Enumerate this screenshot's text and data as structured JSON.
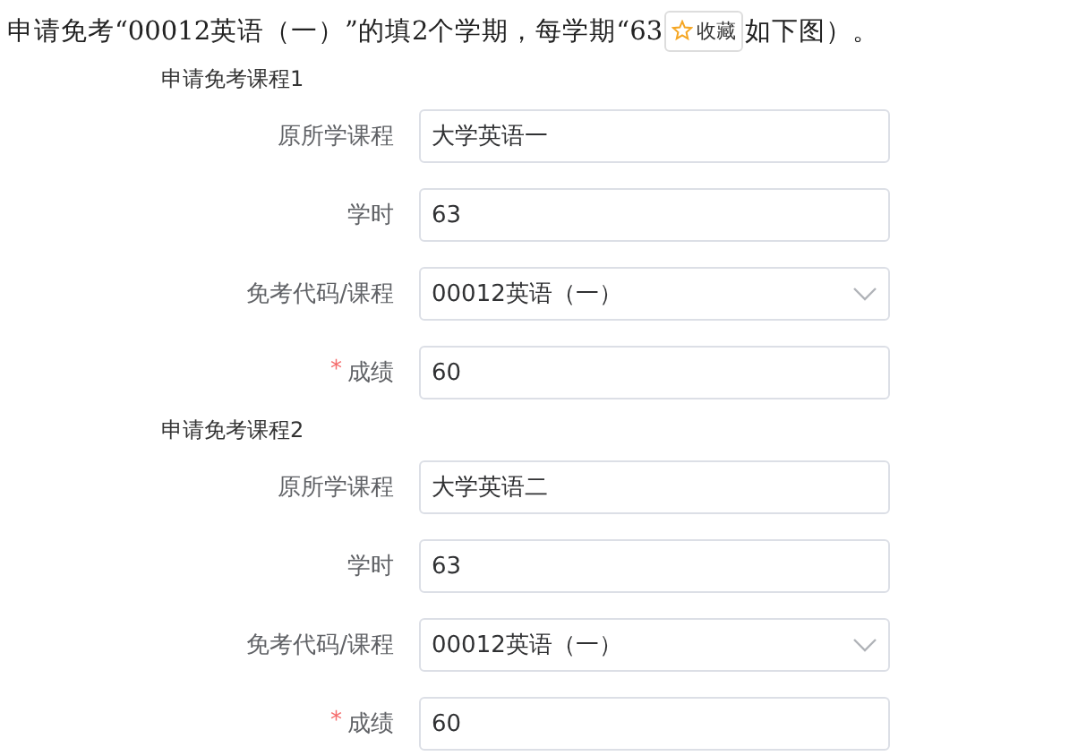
{
  "question": {
    "text_before": "申请免考“00012英语（一）”的填2个学期，每学期“63",
    "text_after": "如下图）。"
  },
  "bookmark_button": {
    "label": "收藏"
  },
  "sections": [
    {
      "title": "申请免考课程1",
      "fields": [
        {
          "label": "原所学课程",
          "kind": "text",
          "value": "大学英语一"
        },
        {
          "label": "学时",
          "kind": "text",
          "value": "63"
        },
        {
          "label": "免考代码/课程",
          "kind": "select",
          "value": "00012英语（一）"
        },
        {
          "required_mark": "*",
          "label": "成绩",
          "kind": "text",
          "value": "60"
        }
      ]
    },
    {
      "title": "申请免考课程2",
      "fields": [
        {
          "label": "原所学课程",
          "kind": "text",
          "value": "大学英语二"
        },
        {
          "label": "学时",
          "kind": "text",
          "value": "63"
        },
        {
          "label": "免考代码/课程",
          "kind": "select",
          "value": "00012英语（一）"
        },
        {
          "required_mark": "*",
          "label": "成绩",
          "kind": "text",
          "value": "60"
        }
      ]
    }
  ]
}
